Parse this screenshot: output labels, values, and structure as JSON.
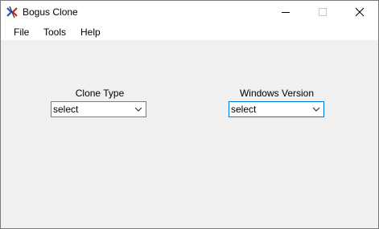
{
  "window": {
    "title": "Bogus Clone",
    "icon": "app-icon"
  },
  "menu": [
    "File",
    "Tools",
    "Help"
  ],
  "form": {
    "clone_type": {
      "label": "Clone Type",
      "value": "select",
      "icon": "chevron-down-icon"
    },
    "windows_version": {
      "label": "Windows Version",
      "value": "select",
      "icon": "chevron-down-icon",
      "focused": true
    }
  },
  "colors": {
    "focus_border": "#0078d7",
    "window_bg": "#f0f0f0"
  }
}
